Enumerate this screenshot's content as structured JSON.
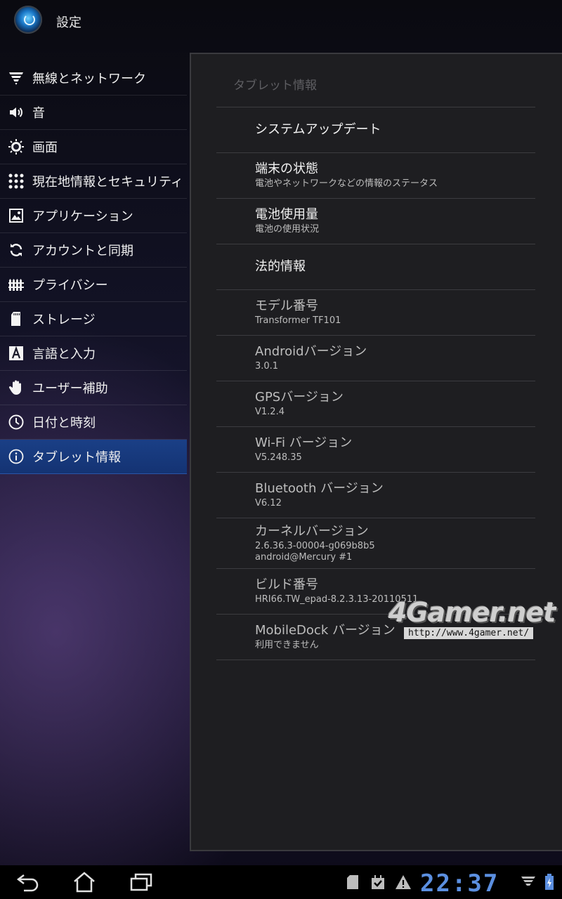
{
  "app": {
    "title": "設定"
  },
  "sidebar": {
    "items": [
      {
        "label": "無線とネットワーク",
        "icon": "wifi-signal-icon"
      },
      {
        "label": "音",
        "icon": "speaker-icon"
      },
      {
        "label": "画面",
        "icon": "brightness-icon"
      },
      {
        "label": "現在地情報とセキュリティ",
        "icon": "grid-dots-icon"
      },
      {
        "label": "アプリケーション",
        "icon": "application-icon"
      },
      {
        "label": "アカウントと同期",
        "icon": "sync-icon"
      },
      {
        "label": "プライバシー",
        "icon": "fence-icon"
      },
      {
        "label": "ストレージ",
        "icon": "sd-card-icon"
      },
      {
        "label": "言語と入力",
        "icon": "language-a-icon"
      },
      {
        "label": "ユーザー補助",
        "icon": "hand-icon"
      },
      {
        "label": "日付と時刻",
        "icon": "clock-icon"
      },
      {
        "label": "タブレット情報",
        "icon": "info-icon",
        "selected": true
      }
    ]
  },
  "main": {
    "section_title": "タブレット情報",
    "rows": [
      {
        "title": "システムアップデート",
        "subtitle": ""
      },
      {
        "title": "端末の状態",
        "subtitle": "電池やネットワークなどの情報のステータス"
      },
      {
        "title": "電池使用量",
        "subtitle": "電池の使用状況"
      },
      {
        "title": "法的情報",
        "subtitle": ""
      },
      {
        "title": "モデル番号",
        "subtitle": "Transformer TF101"
      },
      {
        "title": "Androidバージョン",
        "subtitle": "3.0.1"
      },
      {
        "title": "GPSバージョン",
        "subtitle": "V1.2.4"
      },
      {
        "title": "Wi-Fi バージョン",
        "subtitle": "V5.248.35"
      },
      {
        "title": "Bluetooth バージョン",
        "subtitle": "V6.12"
      },
      {
        "title": "カーネルバージョン",
        "subtitle": "2.6.36.3-00004-g069b8b5",
        "subtitle2": "android@Mercury #1"
      },
      {
        "title": "ビルド番号",
        "subtitle": "HRI66.TW_epad-8.2.3.13-20110511"
      },
      {
        "title": "MobileDock バージョン",
        "subtitle": "利用できません"
      }
    ]
  },
  "watermark": {
    "logo": "4Gamer.net",
    "url": "http://www.4gamer.net/"
  },
  "system_bar": {
    "clock": "22:37",
    "buttons": [
      "back-icon",
      "home-icon",
      "recent-apps-icon"
    ],
    "status_icons": [
      "sd-card-icon",
      "download-check-icon",
      "warning-icon",
      "signal-icon",
      "battery-charging-icon"
    ]
  }
}
